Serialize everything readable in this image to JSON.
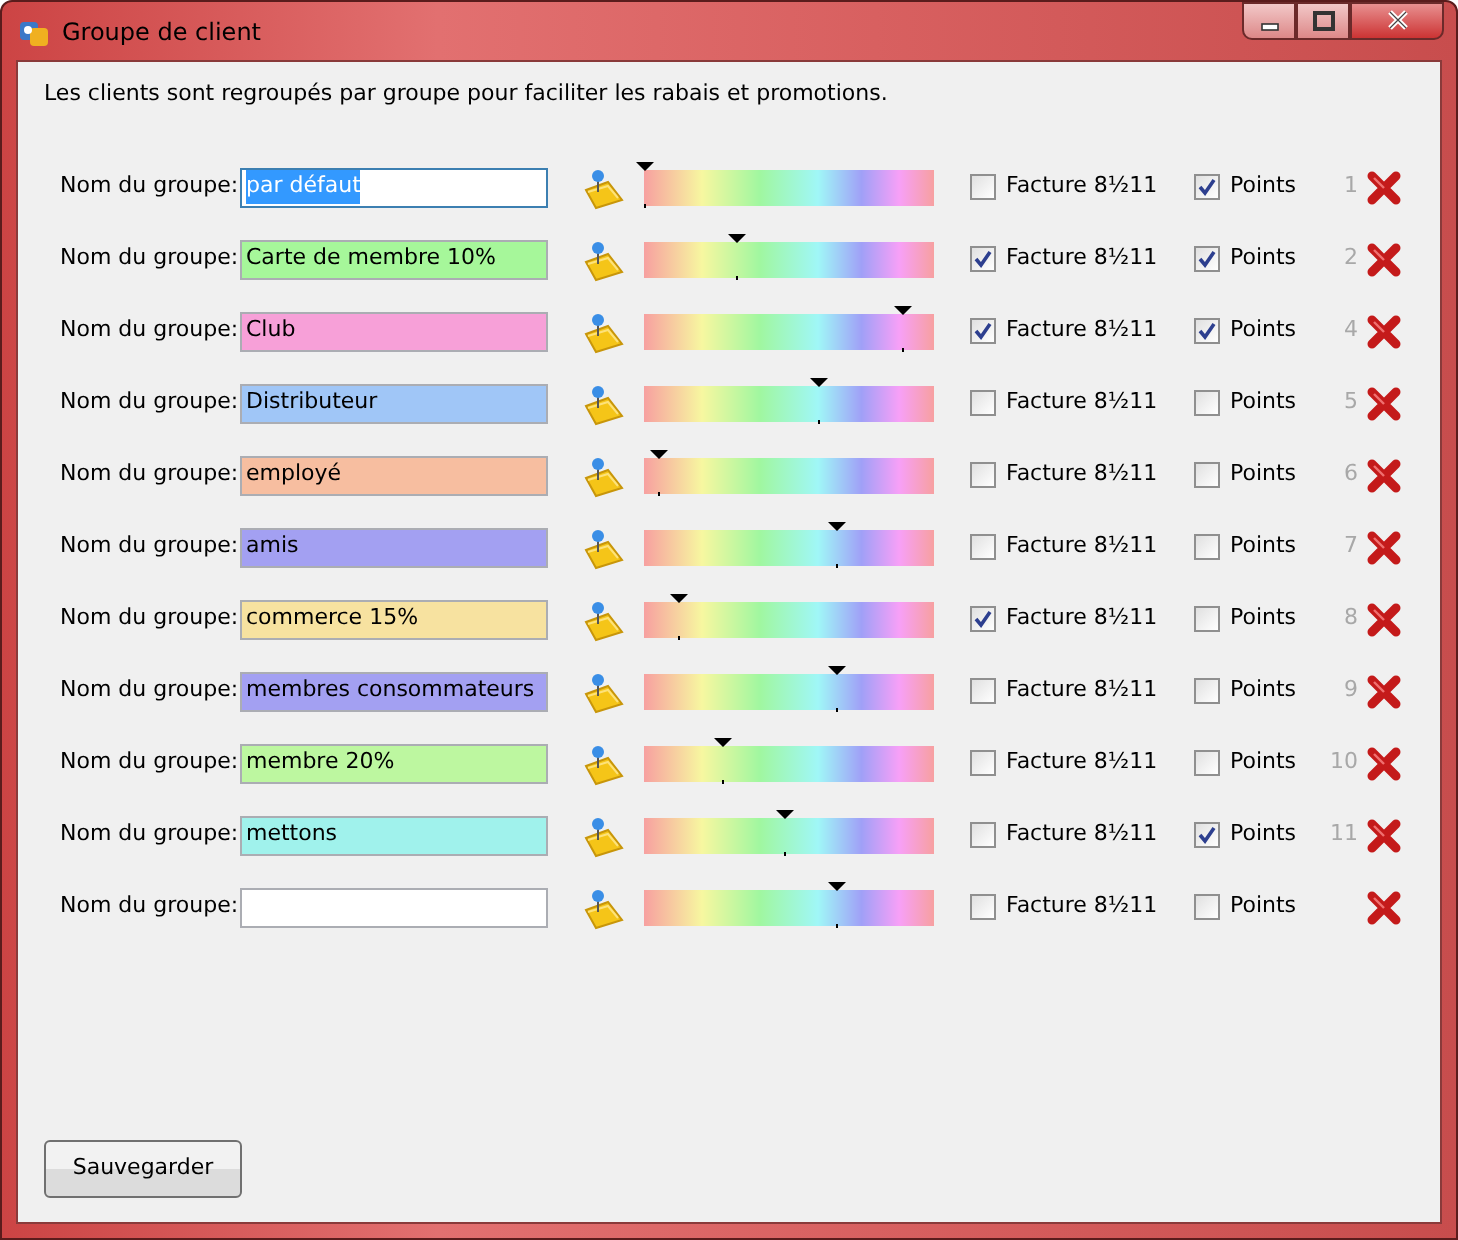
{
  "window": {
    "title": "Groupe de client"
  },
  "intro": "Les clients sont regroupés par groupe pour faciliter les rabais et promotions.",
  "groups": [
    {
      "label": "Nom du groupe:",
      "name": "par défaut",
      "color": "#ffffff",
      "text_highlighted": true,
      "level": 0.0,
      "invoice_label": "Facture 8½11",
      "invoice": false,
      "points_label": "Points",
      "points": true,
      "number": "1"
    },
    {
      "label": "Nom du groupe:",
      "name": "Carte de membre 10%",
      "color": "#a6f79a",
      "text_highlighted": false,
      "level": 0.32,
      "invoice_label": "Facture 8½11",
      "invoice": true,
      "points_label": "Points",
      "points": true,
      "number": "2"
    },
    {
      "label": "Nom du groupe:",
      "name": "Club",
      "color": "#f7a0d8",
      "text_highlighted": false,
      "level": 0.89,
      "invoice_label": "Facture 8½11",
      "invoice": true,
      "points_label": "Points",
      "points": true,
      "number": "4"
    },
    {
      "label": "Nom du groupe:",
      "name": "Distributeur",
      "color": "#a0c6f7",
      "text_highlighted": false,
      "level": 0.6,
      "invoice_label": "Facture 8½11",
      "invoice": false,
      "points_label": "Points",
      "points": false,
      "number": "5"
    },
    {
      "label": "Nom du groupe:",
      "name": "employé",
      "color": "#f7bea0",
      "text_highlighted": false,
      "level": 0.05,
      "invoice_label": "Facture 8½11",
      "invoice": false,
      "points_label": "Points",
      "points": false,
      "number": "6"
    },
    {
      "label": "Nom du groupe:",
      "name": "amis",
      "color": "#a3a0f2",
      "text_highlighted": false,
      "level": 0.66,
      "invoice_label": "Facture 8½11",
      "invoice": false,
      "points_label": "Points",
      "points": false,
      "number": "7"
    },
    {
      "label": "Nom du groupe:",
      "name": "commerce 15%",
      "color": "#f7e2a0",
      "text_highlighted": false,
      "level": 0.12,
      "invoice_label": "Facture 8½11",
      "invoice": true,
      "points_label": "Points",
      "points": false,
      "number": "8"
    },
    {
      "label": "Nom du groupe:",
      "name": "membres consommateurs",
      "color": "#a3a0f2",
      "text_highlighted": false,
      "level": 0.66,
      "invoice_label": "Facture 8½11",
      "invoice": false,
      "points_label": "Points",
      "points": false,
      "number": "9"
    },
    {
      "label": "Nom du groupe:",
      "name": "membre 20%",
      "color": "#bdf7a0",
      "text_highlighted": false,
      "level": 0.27,
      "invoice_label": "Facture 8½11",
      "invoice": false,
      "points_label": "Points",
      "points": false,
      "number": "10"
    },
    {
      "label": "Nom du groupe:",
      "name": "mettons",
      "color": "#a0f2ec",
      "text_highlighted": false,
      "level": 0.48,
      "invoice_label": "Facture 8½11",
      "invoice": false,
      "points_label": "Points",
      "points": true,
      "number": "11"
    },
    {
      "label": "Nom du groupe:",
      "color": "#ffffff",
      "text_highlighted": false,
      "level": 0.66,
      "invoice_label": "Facture 8½11",
      "invoice": false,
      "points_label": "Points",
      "points": false
    }
  ],
  "save_button": "Sauvegarder"
}
